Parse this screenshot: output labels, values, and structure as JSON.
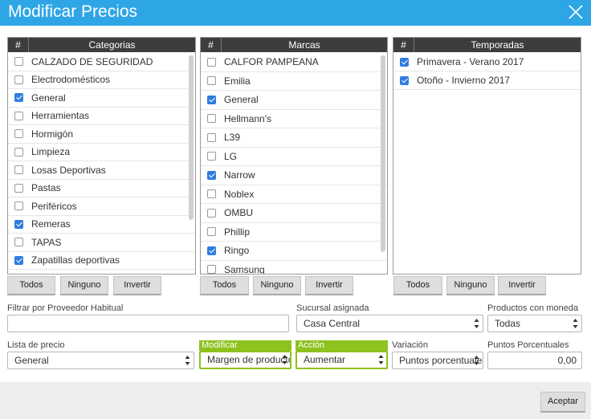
{
  "window": {
    "title": "Modificar Precios"
  },
  "hash": "#",
  "categorias": {
    "header": "Categorias",
    "items": [
      {
        "label": "CALZADO DE SEGURIDAD",
        "checked": false
      },
      {
        "label": "Electrodomésticos",
        "checked": false
      },
      {
        "label": "General",
        "checked": true
      },
      {
        "label": "Herramientas",
        "checked": false
      },
      {
        "label": "Hormigón",
        "checked": false
      },
      {
        "label": "Limpieza",
        "checked": false
      },
      {
        "label": "Losas Deportivas",
        "checked": false
      },
      {
        "label": "Pastas",
        "checked": false
      },
      {
        "label": "Periféricos",
        "checked": false
      },
      {
        "label": "Remeras",
        "checked": true
      },
      {
        "label": "TAPAS",
        "checked": false
      },
      {
        "label": "Zapatillas deportivas",
        "checked": true
      }
    ]
  },
  "marcas": {
    "header": "Marcas",
    "items": [
      {
        "label": "CALFOR PAMPEANA",
        "checked": false
      },
      {
        "label": "Emilia",
        "checked": false
      },
      {
        "label": "General",
        "checked": true
      },
      {
        "label": "Hellmann's",
        "checked": false
      },
      {
        "label": "L39",
        "checked": false
      },
      {
        "label": "LG",
        "checked": false
      },
      {
        "label": "Narrow",
        "checked": true
      },
      {
        "label": "Noblex",
        "checked": false
      },
      {
        "label": "OMBU",
        "checked": false
      },
      {
        "label": "Phillip",
        "checked": false
      },
      {
        "label": "Ringo",
        "checked": true
      },
      {
        "label": "Samsung",
        "checked": false
      }
    ]
  },
  "temporadas": {
    "header": "Temporadas",
    "items": [
      {
        "label": "Primavera - Verano 2017",
        "checked": true
      },
      {
        "label": "Otoño - Invierno 2017",
        "checked": true
      }
    ]
  },
  "buttons": {
    "todos": "Todos",
    "ninguno": "Ninguno",
    "invertir": "Invertir",
    "aceptar": "Aceptar"
  },
  "filters": {
    "proveedor_label": "Filtrar por Proveedor Habitual",
    "proveedor_value": "",
    "sucursal_label": "Sucursal asignada",
    "sucursal_value": "Casa Central",
    "moneda_label": "Productos con moneda",
    "moneda_value": "Todas",
    "lista_label": "Lista de precio",
    "lista_value": "General",
    "modificar_label": "Modificar",
    "modificar_value": "Margen de producto",
    "accion_label": "Acción",
    "accion_value": "Aumentar",
    "variacion_label": "Variación",
    "variacion_value": "Puntos porcentuales",
    "puntos_label": "Puntos Porcentuales",
    "puntos_value": "0,00"
  },
  "colors": {
    "titlebar": "#2ea6e6",
    "check": "#2f7de0",
    "accent_green": "#8dc21f",
    "panel_header": "#3d3d3d"
  }
}
